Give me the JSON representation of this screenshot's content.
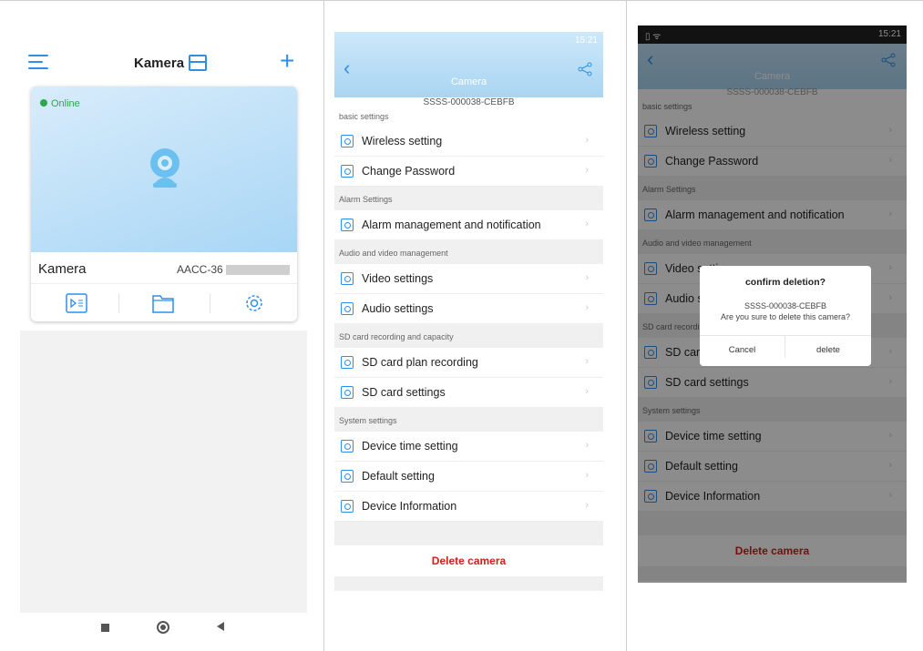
{
  "home": {
    "title": "Kamera",
    "card": {
      "status": "Online",
      "name": "Kamera",
      "device_id": "AACC-36"
    }
  },
  "settings": {
    "device_id": "SSSS-000038-CEBFB",
    "top_title": "Camera",
    "status_time": "15:21",
    "sections": [
      {
        "title": "basic settings",
        "items": [
          "Wireless setting",
          "Change Password"
        ]
      },
      {
        "title": "Alarm Settings",
        "items": [
          "Alarm management and notification"
        ]
      },
      {
        "title": "Audio and video management",
        "items": [
          "Video settings",
          "Audio settings"
        ]
      },
      {
        "title": "SD card recording and capacity",
        "items": [
          "SD card plan recording",
          "SD card settings"
        ]
      },
      {
        "title": "System settings",
        "items": [
          "Device time setting",
          "Default setting",
          "Device Information"
        ]
      }
    ],
    "delete_label": "Delete camera"
  },
  "dialog": {
    "title": "confirm deletion?",
    "device_id": "SSSS-000038-CEBFB",
    "message": "Are you sure to delete this camera?",
    "cancel": "Cancel",
    "confirm": "delete"
  },
  "colors": {
    "accent": "#2f8fe6",
    "danger": "#d0201a",
    "online": "#2aa84a"
  }
}
